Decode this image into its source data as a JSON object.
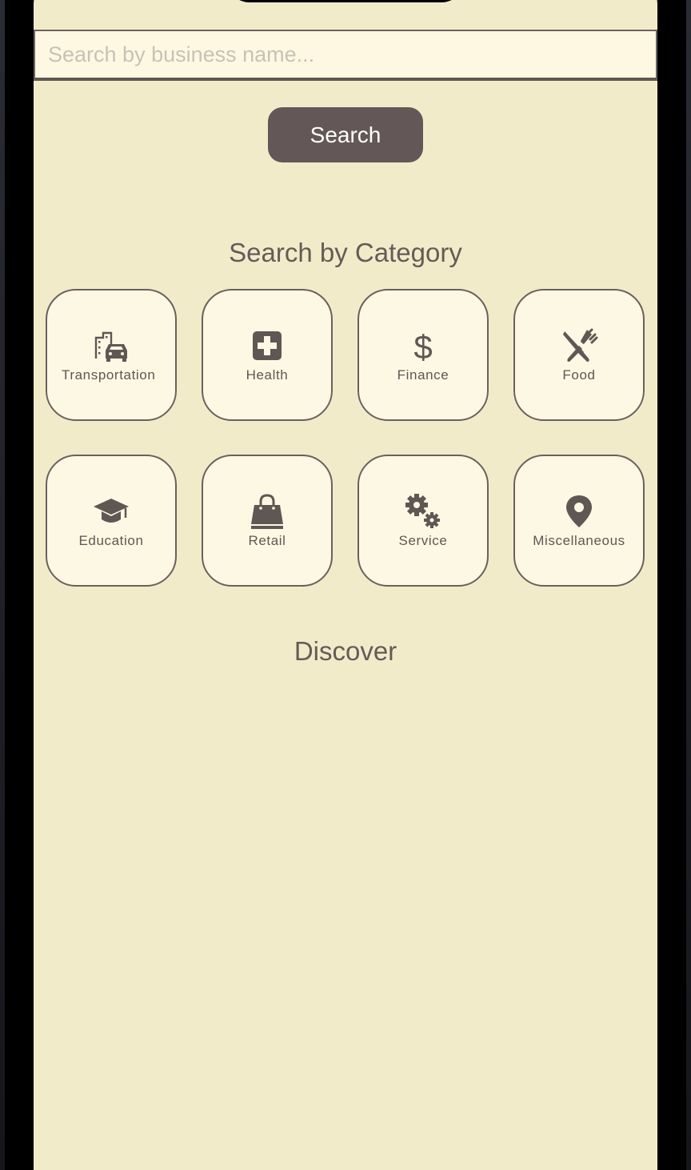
{
  "search": {
    "placeholder": "Search by business name...",
    "button_label": "Search"
  },
  "categories_section": {
    "title": "Search by Category",
    "items": [
      {
        "label": "Transportation",
        "icon": "transportation-icon"
      },
      {
        "label": "Health",
        "icon": "medical-cross-icon"
      },
      {
        "label": "Finance",
        "icon": "dollar-icon"
      },
      {
        "label": "Food",
        "icon": "utensils-icon"
      },
      {
        "label": "Education",
        "icon": "graduation-cap-icon"
      },
      {
        "label": "Retail",
        "icon": "shopping-bag-icon"
      },
      {
        "label": "Service",
        "icon": "gears-icon"
      },
      {
        "label": "Miscellaneous",
        "icon": "map-pin-icon"
      }
    ]
  },
  "discover_section": {
    "title": "Discover"
  },
  "colors": {
    "background": "#f2ebca",
    "tile_fill": "#fdf8e3",
    "accent": "#635857",
    "text": "#655b57"
  }
}
